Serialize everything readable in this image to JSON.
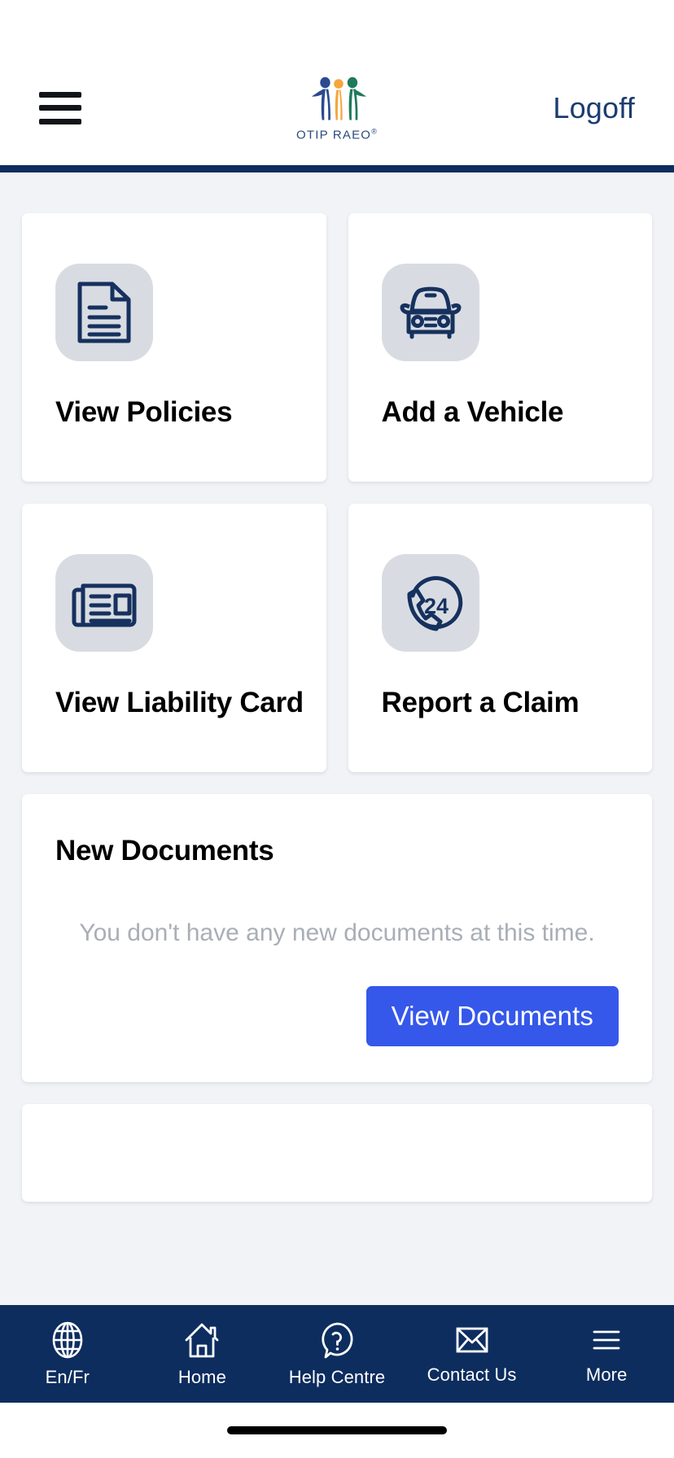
{
  "header": {
    "menu_icon": "hamburger-menu-icon",
    "logo": {
      "icon": "otip-three-figures-logo",
      "text": "OTIP RAEO",
      "trademark": "®",
      "colors": {
        "blue": "#2b4a8f",
        "orange": "#f5a63b",
        "green": "#1f7a5a",
        "text": "#2b4a7d"
      }
    },
    "logoff_label": "Logoff",
    "rule_color": "#0d2d5e"
  },
  "tiles": [
    {
      "icon": "document-icon",
      "label": "View Policies"
    },
    {
      "icon": "car-front-icon",
      "label": "Add a Vehicle"
    },
    {
      "icon": "newspaper-icon",
      "label": "View Liability Card"
    },
    {
      "icon": "phone-24-icon",
      "label": "Report a Claim"
    }
  ],
  "documents_panel": {
    "title": "New Documents",
    "empty_message": "You don't have any new documents at this time.",
    "button_label": "View Documents",
    "button_color": "#3558ea"
  },
  "bottom_nav": [
    {
      "icon": "globe-icon",
      "label": "En/Fr"
    },
    {
      "icon": "home-icon",
      "label": "Home"
    },
    {
      "icon": "question-bubble-icon",
      "label": "Help Centre"
    },
    {
      "icon": "envelope-icon",
      "label": "Contact Us"
    },
    {
      "icon": "hamburger-icon",
      "label": "More"
    }
  ],
  "theme": {
    "navy": "#0d2d5e",
    "page_bg": "#f2f3f7",
    "icon_tile_bg": "#d8dce2",
    "muted_text": "#a9aeb6"
  }
}
